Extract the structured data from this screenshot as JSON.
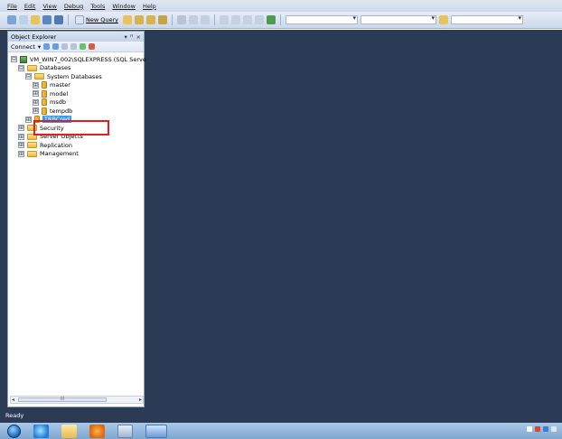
{
  "menubar": {
    "items": [
      "File",
      "Edit",
      "View",
      "Debug",
      "Tools",
      "Window",
      "Help"
    ]
  },
  "toolbar": {
    "new_query_label": "New Query",
    "icons": [
      "new-project-icon",
      "add-item-icon",
      "open-file-icon",
      "save-icon",
      "save-all-icon",
      "query-icon-1",
      "query-icon-2",
      "query-icon-3",
      "query-icon-4",
      "cut-icon",
      "copy-icon",
      "paste-icon",
      "undo-icon",
      "redo-icon",
      "navigate-backward-icon",
      "navigate-forward-icon",
      "debug-start-icon"
    ],
    "accent": "#3a6fb0"
  },
  "object_explorer": {
    "title": "Object Explorer",
    "title_controls": [
      "▾",
      "ꟸ",
      "×"
    ],
    "connect_label": "Connect",
    "server_node": "VM_WIN7_002\\SQLEXPRESS (SQL Serve",
    "databases_label": "Databases",
    "system_databases_label": "System Databases",
    "system_dbs": [
      "master",
      "model",
      "msdb",
      "tempdb"
    ],
    "selected_db": "TRBCred",
    "security_label": "Security",
    "server_objects_label": "Server Objects",
    "replication_label": "Replication",
    "management_label": "Management",
    "expanded_glyph": "⊟",
    "collapsed_glyph": "⊞",
    "scrollbar_thumb_label": "III"
  },
  "status": {
    "text": "Ready"
  },
  "colors": {
    "document_background": "#2b3a55",
    "selection": "#3399ff",
    "highlight_box": "#e02020"
  }
}
